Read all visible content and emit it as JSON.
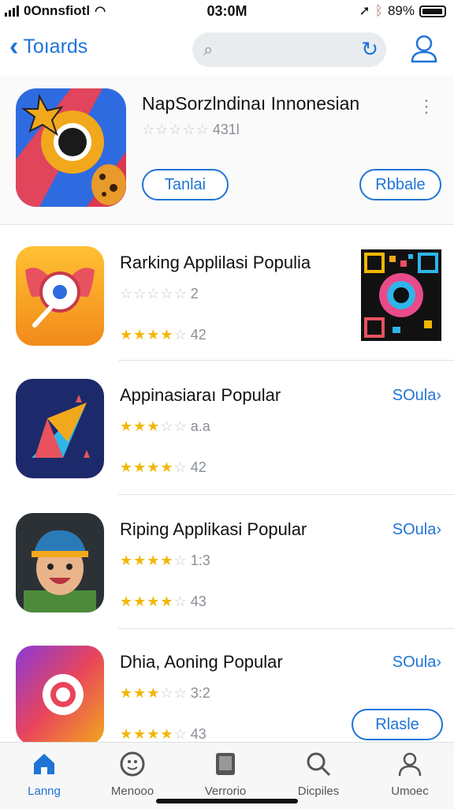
{
  "status": {
    "carrier": "0Onnsfiotl",
    "time": "03:0M",
    "battery": "89%"
  },
  "nav": {
    "back_label": "Toıards"
  },
  "featured": {
    "title": "NapSorzlndinaı Innonesian",
    "rating_count": "431l",
    "left_button": "Tanlai",
    "right_button": "Rbbale",
    "rating": 0
  },
  "apps": [
    {
      "name": "Rarking Applilasi Populia",
      "rating1": "2",
      "rating2": "42",
      "stars1": 0,
      "stars2": 4,
      "link": ""
    },
    {
      "name": "Appinasiaraı Popular",
      "rating1": "a.a",
      "rating2": "42",
      "stars1": 3,
      "stars2": 4,
      "link": "SOula›"
    },
    {
      "name": "Riping Applikasi Popular",
      "rating1": "1:3",
      "rating2": "43",
      "stars1": 4,
      "stars2": 4,
      "link": "SOula›"
    },
    {
      "name": "Dhia, Aoning Popular",
      "rating1": "3:2",
      "rating2": "43",
      "stars1": 3,
      "stars2": 4,
      "link": "SOula›",
      "button": "Rlasle"
    }
  ],
  "tabs": [
    {
      "label": "Lanng",
      "icon": "home-icon",
      "active": true
    },
    {
      "label": "Menooo",
      "icon": "face-icon",
      "active": false
    },
    {
      "label": "Verrorio",
      "icon": "tablet-icon",
      "active": false
    },
    {
      "label": "Dicpiles",
      "icon": "search-icon",
      "active": false
    },
    {
      "label": "Umoec",
      "icon": "person-icon",
      "active": false
    }
  ],
  "colors": {
    "accent": "#1f74d6",
    "star": "#f2b705"
  }
}
